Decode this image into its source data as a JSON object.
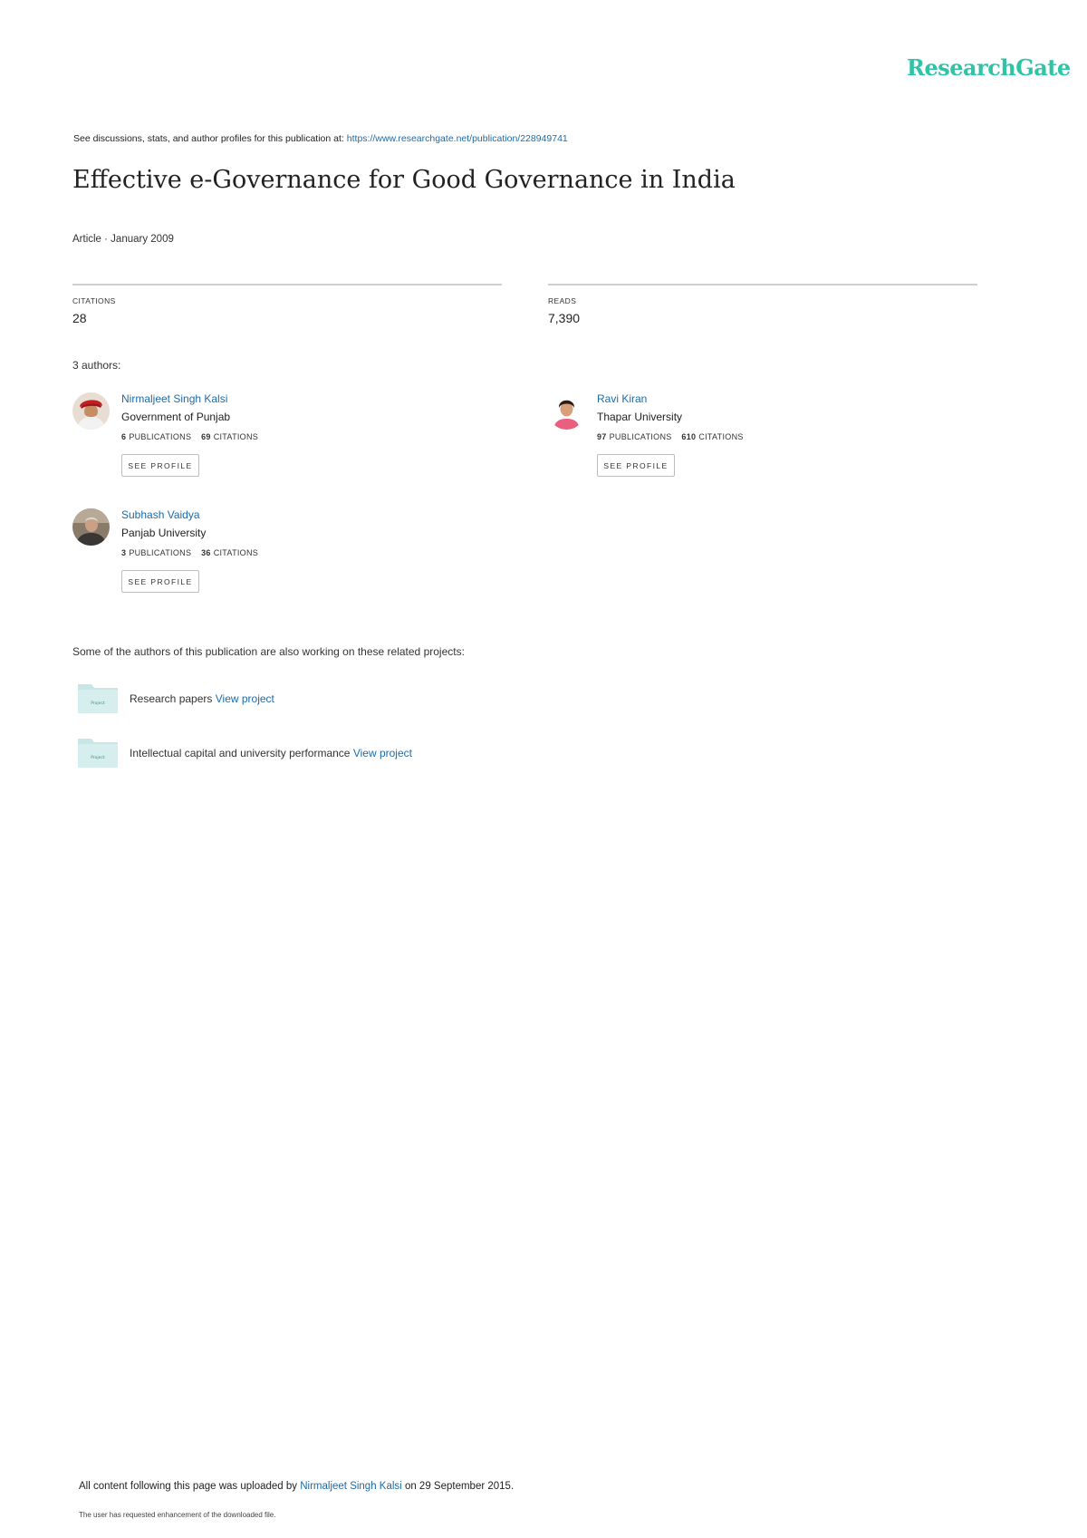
{
  "header": {
    "logo": "ResearchGate",
    "see_prefix": "See discussions, stats, and author profiles for this publication at:",
    "see_url": "https://www.researchgate.net/publication/228949741"
  },
  "publication": {
    "title": "Effective e-Governance for Good Governance in India",
    "meta": "Article · January 2009"
  },
  "stats": {
    "citations_label": "CITATIONS",
    "citations_value": "28",
    "reads_label": "READS",
    "reads_value": "7,390"
  },
  "authors_label": "3 authors:",
  "authors": [
    {
      "name": "Nirmaljeet Singh Kalsi",
      "institution": "Government of Punjab",
      "publications": "6",
      "publications_label": "PUBLICATIONS",
      "citations": "69",
      "citations_label": "CITATIONS",
      "button": "SEE PROFILE"
    },
    {
      "name": "Ravi Kiran",
      "institution": "Thapar University",
      "publications": "97",
      "publications_label": "PUBLICATIONS",
      "citations": "610",
      "citations_label": "CITATIONS",
      "button": "SEE PROFILE"
    },
    {
      "name": "Subhash Vaidya",
      "institution": "Panjab University",
      "publications": "3",
      "publications_label": "PUBLICATIONS",
      "citations": "36",
      "citations_label": "CITATIONS",
      "button": "SEE PROFILE"
    }
  ],
  "projects_heading": "Some of the authors of this publication are also working on these related projects:",
  "projects": [
    {
      "title": "Research papers",
      "link": "View project",
      "folder_label": "Project"
    },
    {
      "title": "Intellectual capital and university performance",
      "link": "View project",
      "folder_label": "Project"
    }
  ],
  "footer": {
    "upload_prefix": "All content following this page was uploaded by",
    "upload_author": "Nirmaljeet Singh Kalsi",
    "upload_suffix": "on 29 September 2015.",
    "note": "The user has requested enhancement of the downloaded file."
  },
  "colors": {
    "brand": "#2ec4a6",
    "link": "#1e6aa8",
    "folder": "#c9e6e6"
  }
}
